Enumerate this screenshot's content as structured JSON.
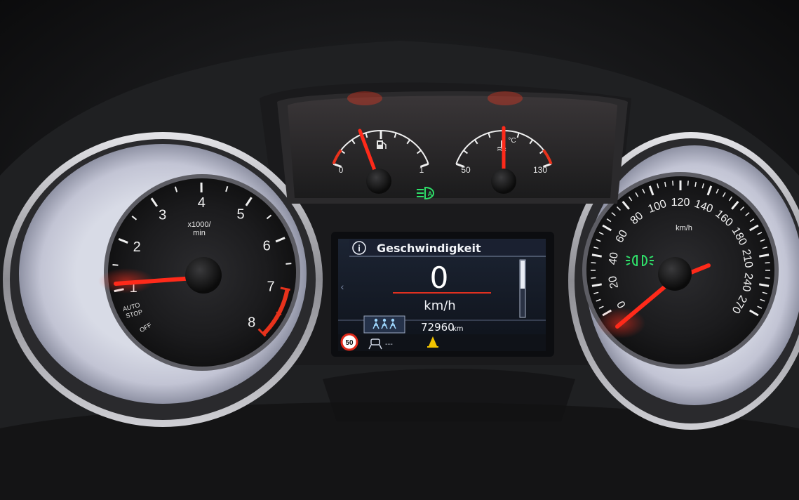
{
  "tachometer": {
    "scale_labels": [
      "1",
      "2",
      "3",
      "4",
      "5",
      "6",
      "7",
      "8"
    ],
    "unit_line1": "x1000/",
    "unit_line2": "min",
    "autostop_line1": "AUTO",
    "autostop_line2": "STOP",
    "autostop_line3": "OFF",
    "needle_value": 0
  },
  "fuel_gauge": {
    "min_label": "0",
    "max_label": "1",
    "icon": "fuel-pump-icon",
    "level": 0.5
  },
  "temp_gauge": {
    "min_label": "50",
    "max_label": "130",
    "unit": "°C",
    "icon": "coolant-temperature-icon",
    "level_celsius": 90
  },
  "indicators": {
    "auto_light": "A",
    "auto_light_icon": "auto-headlight-icon",
    "parking_light_icon": "parking-light-icon"
  },
  "info_display": {
    "info_icon": "i",
    "title": "Geschwindigkeit",
    "value": "0",
    "unit": "km/h",
    "odometer": "72960",
    "odometer_unit": "km",
    "speed_limit": "50",
    "seatbelt_icon": "seatbelt-status-icon",
    "lane_assist_icon": "lane-assist-icon",
    "lane_assist_text": "---",
    "warning_icon": "yellow-warning-icon"
  },
  "speedometer": {
    "scale_labels": [
      "0",
      "20",
      "40",
      "60",
      "80",
      "100",
      "120",
      "140",
      "160",
      "180",
      "210",
      "240",
      "270"
    ],
    "unit": "km/h",
    "speed": 0
  },
  "colors": {
    "needle": "#ff2a1a",
    "indicator_green": "#2fe06a",
    "warning_yellow": "#f2c400",
    "redline": "#e8321c"
  }
}
